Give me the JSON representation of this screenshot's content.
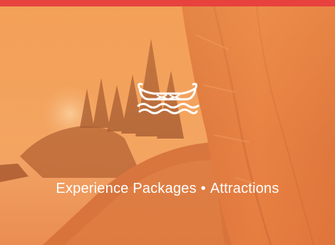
{
  "banner": {
    "topbar_color": "#e8423f",
    "logo_icon": "canoe-icon",
    "link_experience": "Experience Packages",
    "separator": "•",
    "link_attractions": "Attractions"
  }
}
